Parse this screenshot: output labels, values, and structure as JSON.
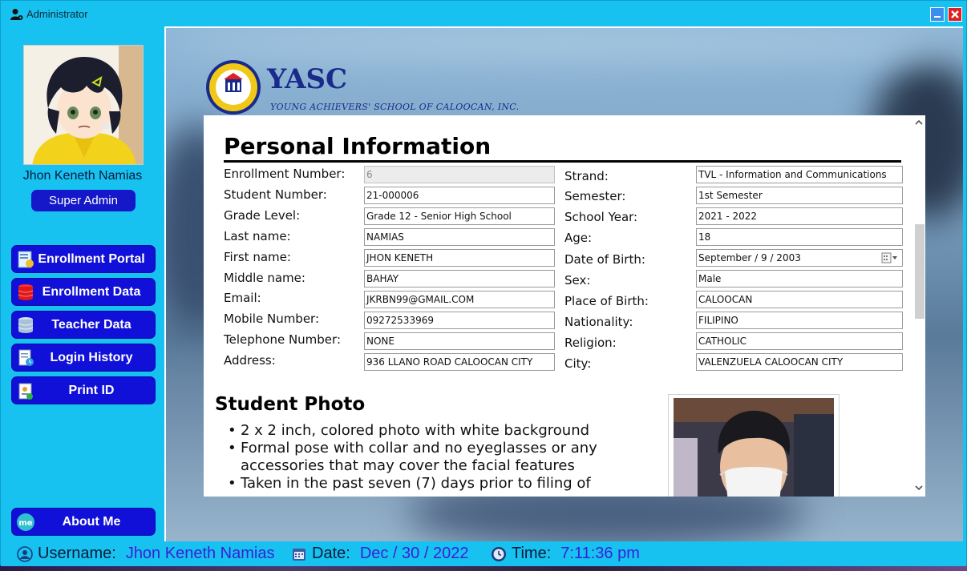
{
  "window": {
    "title": "Administrator",
    "minimize_label": "–",
    "close_label": "✕"
  },
  "sidebar": {
    "user_name": "Jhon Keneth Namias",
    "role": "Super Admin",
    "nav": [
      {
        "label": "Enrollment Portal",
        "icon": "enrollment-portal-icon"
      },
      {
        "label": "Enrollment Data",
        "icon": "database-icon"
      },
      {
        "label": "Teacher Data",
        "icon": "database-icon"
      },
      {
        "label": "Login History",
        "icon": "history-icon"
      },
      {
        "label": "Print ID",
        "icon": "id-card-icon"
      }
    ],
    "about": {
      "label": "About Me",
      "icon_text": "me"
    }
  },
  "school": {
    "name": "YASC",
    "full_name": "YOUNG ACHIEVERS' SCHOOL OF CALOOCAN, INC."
  },
  "personal": {
    "title": "Personal Information",
    "left_fields": [
      {
        "label": "Enrollment Number:",
        "value": "6",
        "disabled": true
      },
      {
        "label": "Student Number:",
        "value": "21-000006"
      },
      {
        "label": "Grade Level:",
        "value": "Grade 12 - Senior High School"
      },
      {
        "label": "Last name:",
        "value": "NAMIAS"
      },
      {
        "label": "First name:",
        "value": "JHON KENETH"
      },
      {
        "label": "Middle name:",
        "value": "BAHAY"
      },
      {
        "label": "Email:",
        "value": "JKRBN99@GMAIL.COM"
      },
      {
        "label": "Mobile Number:",
        "value": "09272533969"
      },
      {
        "label": "Telephone Number:",
        "value": "NONE"
      },
      {
        "label": "Address:",
        "value": "936 LLANO ROAD CALOOCAN CITY"
      }
    ],
    "right_fields": [
      {
        "label": "Strand:",
        "value": "TVL - Information and Communications"
      },
      {
        "label": "Semester:",
        "value": "1st Semester"
      },
      {
        "label": "School Year:",
        "value": "2021 - 2022"
      },
      {
        "label": "Age:",
        "value": "18"
      },
      {
        "label": "Date of Birth:",
        "value": "September /   9 / 2003"
      },
      {
        "label": "Sex:",
        "value": "Male"
      },
      {
        "label": "Place of Birth:",
        "value": "CALOOCAN"
      },
      {
        "label": "Nationality:",
        "value": "FILIPINO"
      },
      {
        "label": "Religion:",
        "value": "CATHOLIC"
      },
      {
        "label": "City:",
        "value": "VALENZUELA CALOOCAN CITY"
      }
    ]
  },
  "photo_section": {
    "title": "Student Photo",
    "bullets": [
      "2 x 2 inch, colored photo with white background",
      "Formal pose with collar and no eyeglasses or any accessories that may cover the facial features",
      "Taken in the past seven (7) days prior to filing of"
    ]
  },
  "status": {
    "username_label": "Username:",
    "username": "Jhon Keneth Namias",
    "date_label": "Date:",
    "date": "Dec / 30 / 2022",
    "time_label": "Time:",
    "time": "7:11:36 pm"
  },
  "colors": {
    "chrome": "#18c2f0",
    "nav_button": "#1010d8",
    "status_value": "#3a20d8",
    "logo": "#1a2a8a"
  }
}
